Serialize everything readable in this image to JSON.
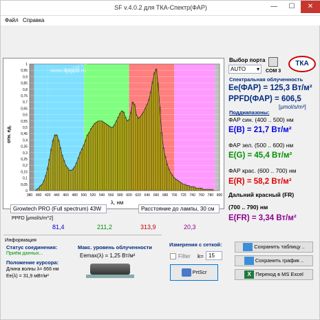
{
  "window": {
    "title": "SF v.4.0.2 для ТКА-Спектр(ФАР)",
    "min": "—",
    "max": "☐",
    "close": "✕"
  },
  "menu": {
    "file": "Файл",
    "help": "Справка"
  },
  "port": {
    "label": "Выбор порта",
    "value": "AUTO",
    "com": "COM 3",
    "logo": "ТКА"
  },
  "spectral": {
    "title": "Спектральная облученность",
    "ee_far": "Ee(ФАР) = 125,3 Вт/м²",
    "ppfd_far": "PPFD(ФАР) = 606,5",
    "ppfd_unit": "[μmol/s/m²]",
    "subranges_title": "Поддиапазоны:",
    "blue_label": "ФАР син. (400 .. 500) нм",
    "blue_value": "E(B) = 21,7 Вт/м²",
    "green_label": "ФАР зел. (500 .. 600) нм",
    "green_value": "E(G) = 45,4 Вт/м²",
    "red_label": "ФАР крас. (600 .. 700) нм",
    "red_value": "E(R) = 58,2 Вт/м²",
    "fr_label": "Дальний красный (FR)",
    "fr_range": "(700 .. 790) нм",
    "fr_value": "E(FR) = 3,34 Вт/м²"
  },
  "chart_info": {
    "lamp": "Growtech PRO (Full spectrum) 43W",
    "distance": "Расстояние до лампы, 30 см",
    "ppfd_label": "PPFD [μmol/s/m^2]",
    "ppfd_values": [
      "81,4",
      "211,2",
      "313,9",
      "20,3"
    ],
    "watermark": "www.tkaspb.ru",
    "watermark2": "ГроуТех"
  },
  "colors": {
    "blue_band": "#7fdfff",
    "green_band": "#7fff7f",
    "red_band": "#ff7f7f",
    "fr_band": "#ff99ff",
    "uv_band": "#999999",
    "ir_band": "#c0c0c0",
    "bar": "#c8b400",
    "title_blue": "#002b80"
  },
  "chart_data": {
    "type": "bar",
    "xlabel": "λ, нм",
    "ylabel": "отн. ед.",
    "xlim": [
      380,
      800
    ],
    "ylim": [
      0,
      1
    ],
    "x_ticks": [
      "380",
      "400",
      "420",
      "440",
      "460",
      "480",
      "500",
      "520",
      "540",
      "560",
      "580",
      "600",
      "620",
      "640",
      "660",
      "680",
      "700",
      "720",
      "740",
      "760",
      "780",
      "800"
    ],
    "y_ticks": [
      "0",
      "0,05",
      "0,1",
      "0,15",
      "0,2",
      "0,25",
      "0,3",
      "0,35",
      "0,4",
      "0,45",
      "0,5",
      "0,55",
      "0,6",
      "0,65",
      "0,7",
      "0,75",
      "0,8",
      "0,85",
      "0,9",
      "0,95",
      "1"
    ],
    "bands": [
      {
        "from": 380,
        "to": 390,
        "color": "#999999"
      },
      {
        "from": 390,
        "to": 420,
        "color": "#7fdfff"
      },
      {
        "from": 420,
        "to": 500,
        "color": "#7fdfff"
      },
      {
        "from": 500,
        "to": 600,
        "color": "#7fff7f"
      },
      {
        "from": 600,
        "to": 700,
        "color": "#ff7f7f"
      },
      {
        "from": 700,
        "to": 790,
        "color": "#ff99ff"
      },
      {
        "from": 790,
        "to": 800,
        "color": "#c0c0c0"
      }
    ],
    "x": [
      392,
      396,
      400,
      404,
      408,
      412,
      416,
      420,
      424,
      428,
      432,
      436,
      440,
      444,
      448,
      452,
      456,
      460,
      464,
      468,
      472,
      476,
      480,
      484,
      488,
      492,
      496,
      500,
      504,
      508,
      512,
      516,
      520,
      524,
      528,
      532,
      536,
      540,
      544,
      548,
      552,
      556,
      560,
      564,
      568,
      572,
      576,
      580,
      584,
      588,
      592,
      596,
      600,
      604,
      608,
      612,
      616,
      620,
      624,
      628,
      632,
      636,
      640,
      644,
      648,
      652,
      656,
      660,
      664,
      668,
      672,
      676,
      680,
      684,
      688,
      692,
      696,
      700,
      704,
      708,
      712,
      716,
      720,
      724,
      728,
      732,
      736,
      740,
      744,
      748,
      752,
      756,
      760,
      764,
      768,
      772,
      776,
      780,
      784,
      788
    ],
    "values": [
      0.0,
      0.01,
      0.02,
      0.04,
      0.05,
      0.08,
      0.12,
      0.18,
      0.25,
      0.33,
      0.4,
      0.44,
      0.44,
      0.4,
      0.34,
      0.28,
      0.24,
      0.2,
      0.18,
      0.16,
      0.16,
      0.17,
      0.19,
      0.22,
      0.26,
      0.3,
      0.33,
      0.36,
      0.4,
      0.44,
      0.46,
      0.49,
      0.51,
      0.53,
      0.54,
      0.55,
      0.55,
      0.55,
      0.54,
      0.53,
      0.52,
      0.51,
      0.5,
      0.5,
      0.52,
      0.55,
      0.58,
      0.61,
      0.63,
      0.62,
      0.58,
      0.55,
      0.56,
      0.62,
      0.7,
      0.68,
      0.6,
      0.57,
      0.58,
      0.6,
      0.62,
      0.65,
      0.68,
      0.72,
      0.78,
      0.86,
      0.93,
      0.96,
      0.85,
      0.66,
      0.46,
      0.34,
      0.27,
      0.21,
      0.17,
      0.14,
      0.12,
      0.1,
      0.09,
      0.08,
      0.07,
      0.06,
      0.05,
      0.05,
      0.04,
      0.04,
      0.03,
      0.03,
      0.03,
      0.02,
      0.02,
      0.02,
      0.02,
      0.01,
      0.01,
      0.01,
      0.01,
      0.01,
      0.01,
      0.0
    ]
  },
  "info": {
    "section": "Информация",
    "status_label": "Статус соединения:",
    "status_value": "Приём данных...",
    "max_label": "Макс. уровень облученности",
    "max_value": "Eemax(λ) = 1,25 Вт/м²",
    "cursor_label": "Положение курсора:",
    "wavelength": "Длина волны λ= 666 нм",
    "ee_lambda": "Ee(λ) = 31,9 мВт/м²",
    "grid_label": "Измерения с сеткой:",
    "filter_label": "Filter",
    "k_label": "k=",
    "k_value": "15",
    "printscr": "PrtScr",
    "save_table": "Сохранить таблицу ..",
    "save_graph": "Сохранить график ..",
    "excel": "Переход в MS Excel"
  }
}
